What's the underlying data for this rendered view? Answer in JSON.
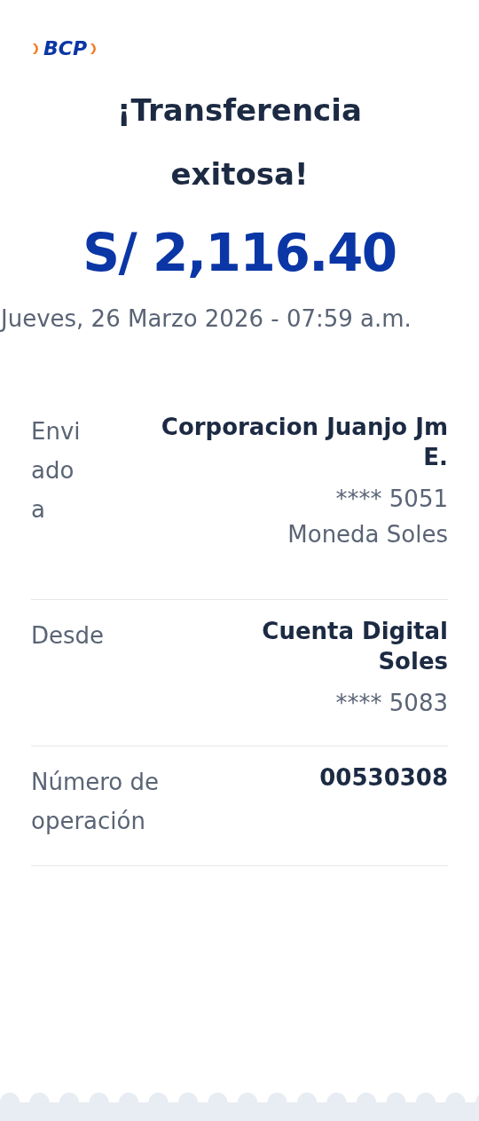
{
  "logo": {
    "text": "BCP"
  },
  "title": "¡Transferencia exitosa!",
  "amount": "S/ 2,116.40",
  "datetime": "Jueves, 26 Marzo 2026 - 07:59 a.m.",
  "details": [
    {
      "label": "Enviado a",
      "lines": [
        {
          "text": "Corporacion Juanjo Jm E.",
          "bold": true
        },
        {
          "text": "**** 5051",
          "bold": false
        },
        {
          "text": "Moneda Soles",
          "bold": false
        }
      ]
    },
    {
      "label": "Desde",
      "lines": [
        {
          "text": "Cuenta Digital Soles",
          "bold": true
        },
        {
          "text": "**** 5083",
          "bold": false
        }
      ]
    },
    {
      "label": "Número de operación",
      "lines": [
        {
          "text": "00530308",
          "bold": true
        }
      ]
    }
  ]
}
